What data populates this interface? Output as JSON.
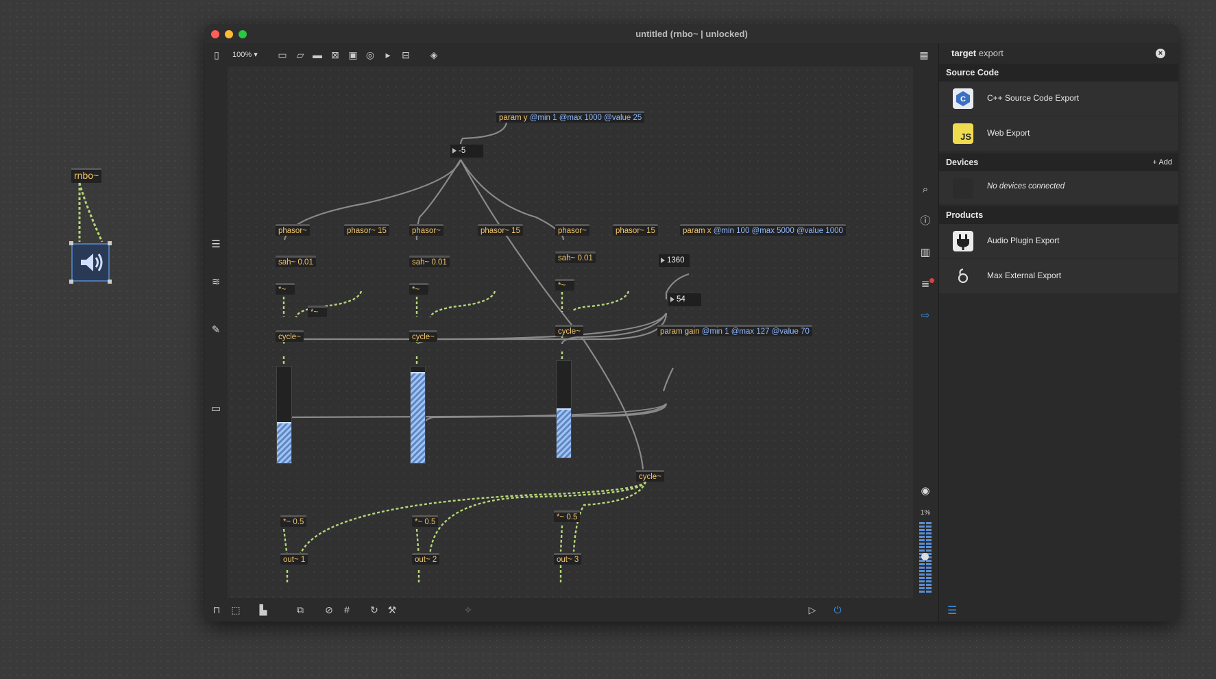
{
  "window": {
    "title": "untitled (rnbo~ | unlocked)",
    "zoom": "100%"
  },
  "outer": {
    "rnbo_label": "rnbo~"
  },
  "patch": {
    "param_y": {
      "name": "param y",
      "attrs": "@min 1 @max 1000 @value 25",
      "min": "@min 1",
      "max": "@max 1000",
      "value": "@value 25"
    },
    "param_x": {
      "name": "param x",
      "min": "@min 100",
      "max": "@max 5000",
      "value": "@value 1000"
    },
    "param_gain": {
      "name": "param gain",
      "min": "@min 1",
      "max": "@max 127",
      "value": "@value 70"
    },
    "num_neg5": "-5",
    "num_1360": "1360",
    "num_54": "54",
    "phasor": "phasor~",
    "phasor15": "phasor~ 15",
    "sah": "sah~ 0.01",
    "mult": "*~",
    "cycle": "cycle~",
    "mult05": "*~ 0.5",
    "out1": "out~ 1",
    "out2": "out~ 2",
    "out3": "out~ 3",
    "slider_levels": [
      0.41,
      0.93,
      0.5
    ]
  },
  "panel": {
    "target_label": "target",
    "target_value": "export",
    "source_code_header": "Source Code",
    "cpp_export": "C++ Source Code Export",
    "web_export": "Web Export",
    "js_badge": "JS",
    "devices_header": "Devices",
    "add_label": "+ Add",
    "no_devices": "No devices connected",
    "products_header": "Products",
    "audio_plugin_export": "Audio Plugin Export",
    "max_external_export": "Max External Export"
  },
  "rightbar": {
    "cpu": "1%"
  },
  "colors": {
    "object_text": "#f0c36a",
    "attr_text": "#8fb8ff",
    "signal_cord": "#b7d77a",
    "accent_blue": "#3d8ee6",
    "red_close": "#ff5f57",
    "yellow_min": "#febc2e",
    "green_max": "#28c840"
  }
}
